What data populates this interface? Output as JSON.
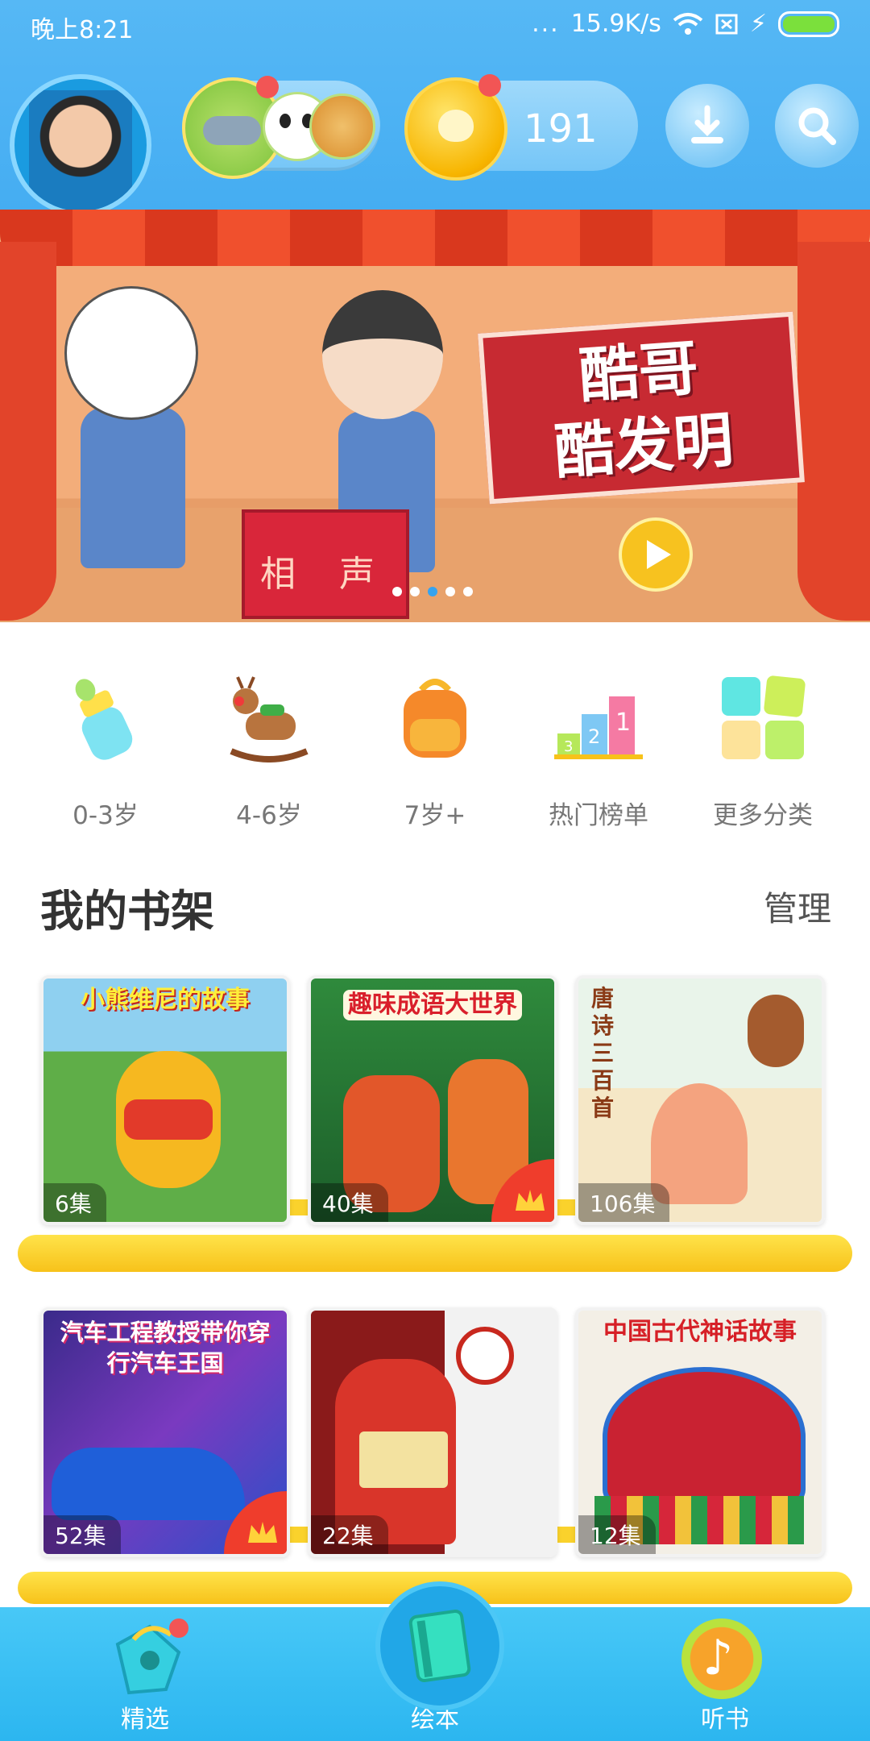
{
  "status_bar": {
    "time": "晚上8:21",
    "dots": "...",
    "speed": "15.9K/s"
  },
  "header": {
    "coin_count": "191",
    "icons": [
      "avatar",
      "animal-collection-icon",
      "coin-icon",
      "download-icon",
      "search-icon"
    ]
  },
  "banner": {
    "title_line1": "酷哥",
    "title_line2": "酷发明",
    "prop_text": "相 声",
    "slide_count": 5,
    "active_slide": 3
  },
  "categories": [
    {
      "label": "0-3岁",
      "icon": "baby-bottle-icon"
    },
    {
      "label": "4-6岁",
      "icon": "rocking-horse-icon"
    },
    {
      "label": "7岁+",
      "icon": "backpack-icon"
    },
    {
      "label": "热门榜单",
      "icon": "podium-icon"
    },
    {
      "label": "更多分类",
      "icon": "grid-icon"
    }
  ],
  "shelf": {
    "title": "我的书架",
    "manage_label": "管理",
    "books": [
      {
        "title": "小熊维尼的故事",
        "episodes": "6集",
        "vip": false
      },
      {
        "title": "趣味成语大世界",
        "episodes": "40集",
        "vip": true
      },
      {
        "title": "唐诗三百首",
        "episodes": "106集",
        "vip": false
      },
      {
        "title": "汽车工程教授带你穿行汽车王国",
        "episodes": "52集",
        "vip": true
      },
      {
        "title": "",
        "episodes": "22集",
        "vip": false
      },
      {
        "title": "中国古代神话故事",
        "episodes": "12集",
        "vip": false
      }
    ]
  },
  "tabbar": {
    "tabs": [
      {
        "label": "精选",
        "icon": "gift-tag-icon"
      },
      {
        "label": "绘本",
        "icon": "book-icon"
      },
      {
        "label": "听书",
        "icon": "music-note-icon"
      }
    ]
  },
  "colors": {
    "header_blue": "#4fb3f4",
    "accent_yellow": "#f7c21a",
    "tab_blue": "#2cb6f0",
    "badge_red": "#f25555"
  }
}
